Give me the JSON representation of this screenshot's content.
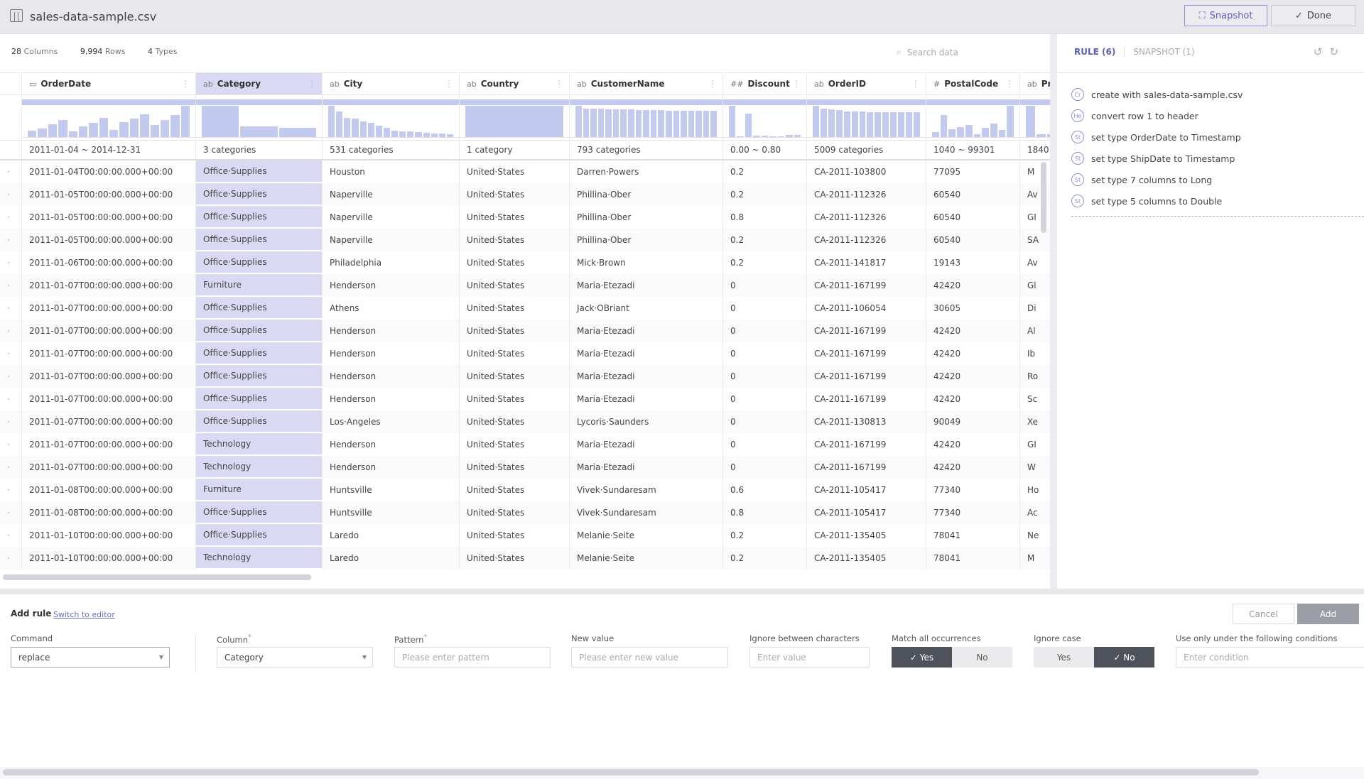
{
  "header": {
    "title": "sales-data-sample.csv",
    "snapshot_label": "Snapshot",
    "done_label": "Done"
  },
  "stats": {
    "columns": "28",
    "columns_label": "Columns",
    "rows": "9,994",
    "rows_label": "Rows",
    "types": "4",
    "types_label": "Types"
  },
  "search": {
    "placeholder": "Search data"
  },
  "accent_color": "#5a5fb8",
  "columns": [
    {
      "type": "date-icon",
      "type_label": "▭",
      "name": "OrderDate",
      "summary": "2011-01-04 ~ 2014-12-31",
      "hist": [
        20,
        28,
        42,
        55,
        18,
        35,
        45,
        62,
        22,
        48,
        58,
        72,
        38,
        55,
        70,
        100
      ]
    },
    {
      "type": "string",
      "type_label": "ab",
      "name": "Category",
      "summary": "3 categories",
      "hist": [
        100,
        35,
        30
      ],
      "selected": true
    },
    {
      "type": "string",
      "type_label": "ab",
      "name": "City",
      "summary": "531 categories",
      "hist": [
        100,
        82,
        62,
        58,
        50,
        45,
        36,
        30,
        20,
        18,
        18,
        15,
        14,
        12,
        12,
        10
      ]
    },
    {
      "type": "string",
      "type_label": "ab",
      "name": "Country",
      "summary": "1 category",
      "hist": [
        100
      ]
    },
    {
      "type": "string",
      "type_label": "ab",
      "name": "CustomerName",
      "summary": "793 categories",
      "hist": [
        100,
        92,
        92,
        92,
        88,
        88,
        88,
        88,
        86,
        86,
        86,
        86,
        84,
        84,
        84,
        84,
        84,
        84,
        84
      ]
    },
    {
      "type": "double",
      "type_label": "##",
      "name": "Discount",
      "summary": "0.00 ~ 0.80",
      "hist": [
        100,
        3,
        76,
        5,
        5,
        3,
        3,
        7,
        6
      ]
    },
    {
      "type": "string",
      "type_label": "ab",
      "name": "OrderID",
      "summary": "5009 categories",
      "hist": [
        100,
        92,
        88,
        86,
        82,
        82,
        82,
        80,
        80,
        80,
        80,
        80,
        80,
        80
      ]
    },
    {
      "type": "long",
      "type_label": "#",
      "name": "PostalCode",
      "summary": "1040 ~ 99301",
      "hist": [
        16,
        70,
        25,
        32,
        38,
        10,
        30,
        44,
        22,
        100
      ]
    },
    {
      "type": "string",
      "type_label": "ab",
      "name": "Pr",
      "summary": "1840",
      "hist": [
        100,
        8,
        8
      ]
    }
  ],
  "rows": [
    [
      "2011-01-04T00:00:00.000+00:00",
      "Office·Supplies",
      "Houston",
      "United·States",
      "Darren·Powers",
      "0.2",
      "CA-2011-103800",
      "77095",
      "M"
    ],
    [
      "2011-01-05T00:00:00.000+00:00",
      "Office·Supplies",
      "Naperville",
      "United·States",
      "Phillina·Ober",
      "0.2",
      "CA-2011-112326",
      "60540",
      "Av"
    ],
    [
      "2011-01-05T00:00:00.000+00:00",
      "Office·Supplies",
      "Naperville",
      "United·States",
      "Phillina·Ober",
      "0.8",
      "CA-2011-112326",
      "60540",
      "GI"
    ],
    [
      "2011-01-05T00:00:00.000+00:00",
      "Office·Supplies",
      "Naperville",
      "United·States",
      "Phillina·Ober",
      "0.2",
      "CA-2011-112326",
      "60540",
      "SA"
    ],
    [
      "2011-01-06T00:00:00.000+00:00",
      "Office·Supplies",
      "Philadelphia",
      "United·States",
      "Mick·Brown",
      "0.2",
      "CA-2011-141817",
      "19143",
      "Av"
    ],
    [
      "2011-01-07T00:00:00.000+00:00",
      "Furniture",
      "Henderson",
      "United·States",
      "Maria·Etezadi",
      "0",
      "CA-2011-167199",
      "42420",
      "Gl"
    ],
    [
      "2011-01-07T00:00:00.000+00:00",
      "Office·Supplies",
      "Athens",
      "United·States",
      "Jack·OBriant",
      "0",
      "CA-2011-106054",
      "30605",
      "Di"
    ],
    [
      "2011-01-07T00:00:00.000+00:00",
      "Office·Supplies",
      "Henderson",
      "United·States",
      "Maria·Etezadi",
      "0",
      "CA-2011-167199",
      "42420",
      "Al"
    ],
    [
      "2011-01-07T00:00:00.000+00:00",
      "Office·Supplies",
      "Henderson",
      "United·States",
      "Maria·Etezadi",
      "0",
      "CA-2011-167199",
      "42420",
      "Ib"
    ],
    [
      "2011-01-07T00:00:00.000+00:00",
      "Office·Supplies",
      "Henderson",
      "United·States",
      "Maria·Etezadi",
      "0",
      "CA-2011-167199",
      "42420",
      "Ro"
    ],
    [
      "2011-01-07T00:00:00.000+00:00",
      "Office·Supplies",
      "Henderson",
      "United·States",
      "Maria·Etezadi",
      "0",
      "CA-2011-167199",
      "42420",
      "Sc"
    ],
    [
      "2011-01-07T00:00:00.000+00:00",
      "Office·Supplies",
      "Los·Angeles",
      "United·States",
      "Lycoris·Saunders",
      "0",
      "CA-2011-130813",
      "90049",
      "Xe"
    ],
    [
      "2011-01-07T00:00:00.000+00:00",
      "Technology",
      "Henderson",
      "United·States",
      "Maria·Etezadi",
      "0",
      "CA-2011-167199",
      "42420",
      "GI"
    ],
    [
      "2011-01-07T00:00:00.000+00:00",
      "Technology",
      "Henderson",
      "United·States",
      "Maria·Etezadi",
      "0",
      "CA-2011-167199",
      "42420",
      "W"
    ],
    [
      "2011-01-08T00:00:00.000+00:00",
      "Furniture",
      "Huntsville",
      "United·States",
      "Vivek·Sundaresam",
      "0.6",
      "CA-2011-105417",
      "77340",
      "Ho"
    ],
    [
      "2011-01-08T00:00:00.000+00:00",
      "Office·Supplies",
      "Huntsville",
      "United·States",
      "Vivek·Sundaresam",
      "0.8",
      "CA-2011-105417",
      "77340",
      "Ac"
    ],
    [
      "2011-01-10T00:00:00.000+00:00",
      "Office·Supplies",
      "Laredo",
      "United·States",
      "Melanie·Seite",
      "0.2",
      "CA-2011-135405",
      "78041",
      "Ne"
    ],
    [
      "2011-01-10T00:00:00.000+00:00",
      "Technology",
      "Laredo",
      "United·States",
      "Melanie·Seite",
      "0.2",
      "CA-2011-135405",
      "78041",
      "M"
    ]
  ],
  "right_panel": {
    "rule_tab": "RULE (6)",
    "snapshot_tab": "SNAPSHOT (1)",
    "rules": [
      {
        "badge": "Cr",
        "text": "create with sales-data-sample.csv"
      },
      {
        "badge": "He",
        "text": "convert row 1 to header"
      },
      {
        "badge": "St",
        "text": "set type OrderDate to Timestamp"
      },
      {
        "badge": "St",
        "text": "set type ShipDate to Timestamp"
      },
      {
        "badge": "St",
        "text": "set type 7 columns to Long"
      },
      {
        "badge": "St",
        "text": "set type 5 columns to Double"
      }
    ]
  },
  "add_rule": {
    "title": "Add rule",
    "switch_label": "Switch to editor",
    "cancel_label": "Cancel",
    "add_label": "Add",
    "command_label": "Command",
    "command_value": "replace",
    "column_label": "Column",
    "column_value": "Category",
    "pattern_label": "Pattern",
    "pattern_placeholder": "Please enter pattern",
    "new_value_label": "New value",
    "new_value_placeholder": "Please enter new value",
    "ignore_between_label": "Ignore between characters",
    "ignore_between_placeholder": "Enter value",
    "match_all_label": "Match all occurrences",
    "match_all_value": "Yes",
    "ignore_case_label": "Ignore case",
    "ignore_case_value": "No",
    "yes_label": "Yes",
    "no_label": "No",
    "condition_label": "Use only under the following conditions",
    "condition_placeholder": "Enter condition",
    "required_mark": "*"
  }
}
